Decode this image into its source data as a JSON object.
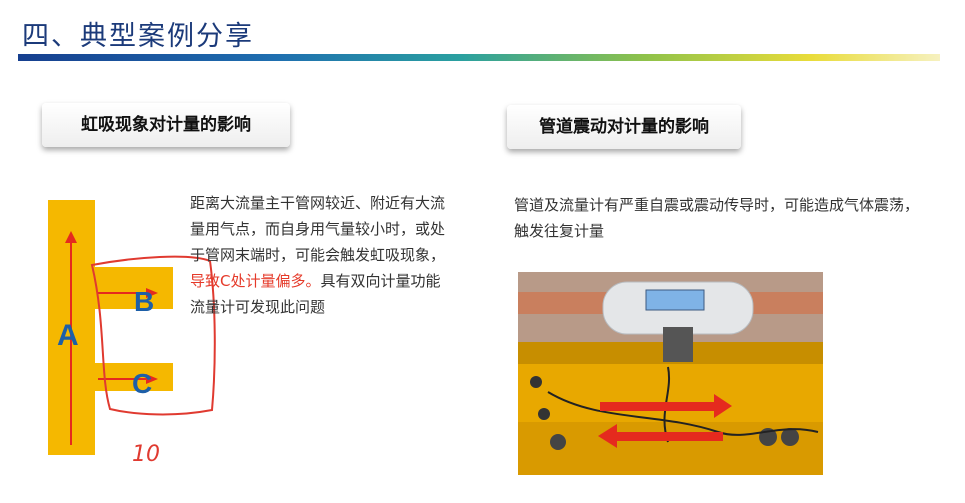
{
  "title": "四、典型案例分享",
  "left": {
    "heading": "虹吸现象对计量的影响",
    "desc_part1": "距离大流量主干管网较近、附近有大流量用气点，而自身用气量较小时，或处于管网末端时，可能会触发虹吸现象，",
    "desc_highlight": "导致C处计量偏多。",
    "desc_part2": "具有双向计量功能流量计可发现此问题",
    "diagram": {
      "label_a": "A",
      "label_b": "B",
      "label_c": "C",
      "handwriting": "10"
    }
  },
  "right": {
    "heading": "管道震动对计量的影响",
    "desc": "管道及流量计有严重自震或震动传导时，可能造成气体震荡，触发往复计量"
  },
  "colors": {
    "title_blue": "#1b3a7a",
    "pipe_yellow": "#f5b800",
    "arrow_red": "#e52a1e",
    "highlight_red": "#e53a2a",
    "letter_blue": "#1d5fa8"
  }
}
